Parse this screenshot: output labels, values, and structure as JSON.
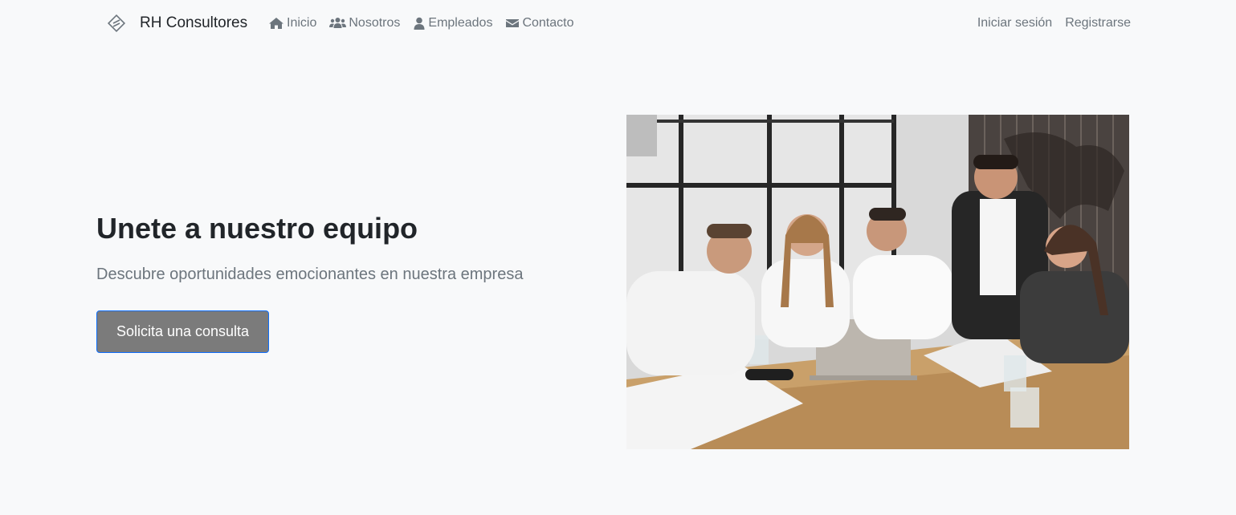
{
  "nav": {
    "brand": "RH Consultores",
    "links": [
      {
        "label": "Inicio",
        "icon": "home-icon"
      },
      {
        "label": "Nosotros",
        "icon": "users-icon"
      },
      {
        "label": "Empleados",
        "icon": "user-icon"
      },
      {
        "label": "Contacto",
        "icon": "envelope-icon"
      }
    ],
    "login": "Iniciar sesión",
    "register": "Registrarse"
  },
  "hero": {
    "title": "Unete a nuestro equipo",
    "subtitle": "Descubre oportunidades emocionantes en nuestra empresa",
    "cta_label": "Solicita una consulta",
    "image_alt": "team-meeting-photo"
  },
  "colors": {
    "background": "#f8f9fa",
    "muted_text": "#6c757d",
    "button_bg": "#7b7b7b",
    "button_border": "#0d6efd"
  }
}
